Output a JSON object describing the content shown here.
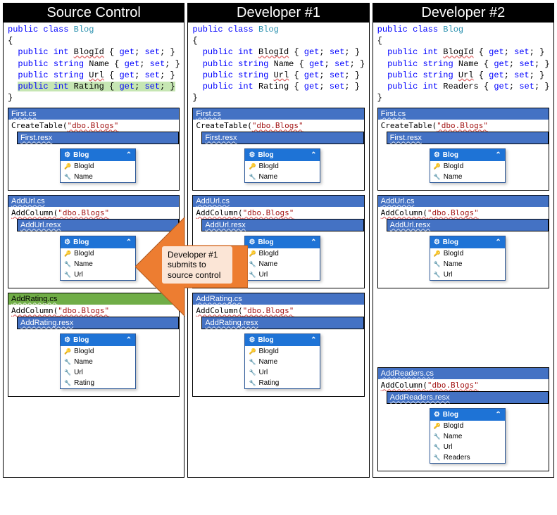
{
  "columns": {
    "source": {
      "title": "Source Control"
    },
    "dev1": {
      "title": "Developer #1"
    },
    "dev2": {
      "title": "Developer #2"
    }
  },
  "code": {
    "kw_public": "public",
    "kw_class": "class",
    "kw_int": "int",
    "kw_string": "string",
    "kw_get": "get",
    "kw_set": "set",
    "type_blog": "Blog",
    "prop_blogid": "BlogId",
    "prop_name": "Name",
    "prop_url": "Url",
    "prop_rating": "Rating",
    "prop_readers": "Readers"
  },
  "migrations": {
    "first_cs": "First.cs",
    "first_resx": "First.resx",
    "first_code": "CreateTable(",
    "first_arg": "\"dbo.Blogs\"",
    "addurl_cs": "AddUrl.cs",
    "addurl_resx": "AddUrl.resx",
    "addurl_code": "AddColumn(",
    "addurl_arg": "\"dbo.Blogs\"",
    "addrating_cs": "AddRating.cs",
    "addrating_resx": "AddRating.resx",
    "addrating_code": "AddColumn(",
    "addrating_arg": "\"dbo.Blogs\"",
    "addreaders_cs": "AddReaders.cs",
    "addreaders_resx": "AddReaders.resx",
    "addreaders_code": "AddColumn(",
    "addreaders_arg": "\"dbo.Blogs\""
  },
  "entity": {
    "name": "Blog",
    "blogid": "BlogId",
    "name_prop": "Name",
    "url": "Url",
    "rating": "Rating",
    "readers": "Readers"
  },
  "arrow": {
    "label": "Developer #1 submits to source control"
  }
}
